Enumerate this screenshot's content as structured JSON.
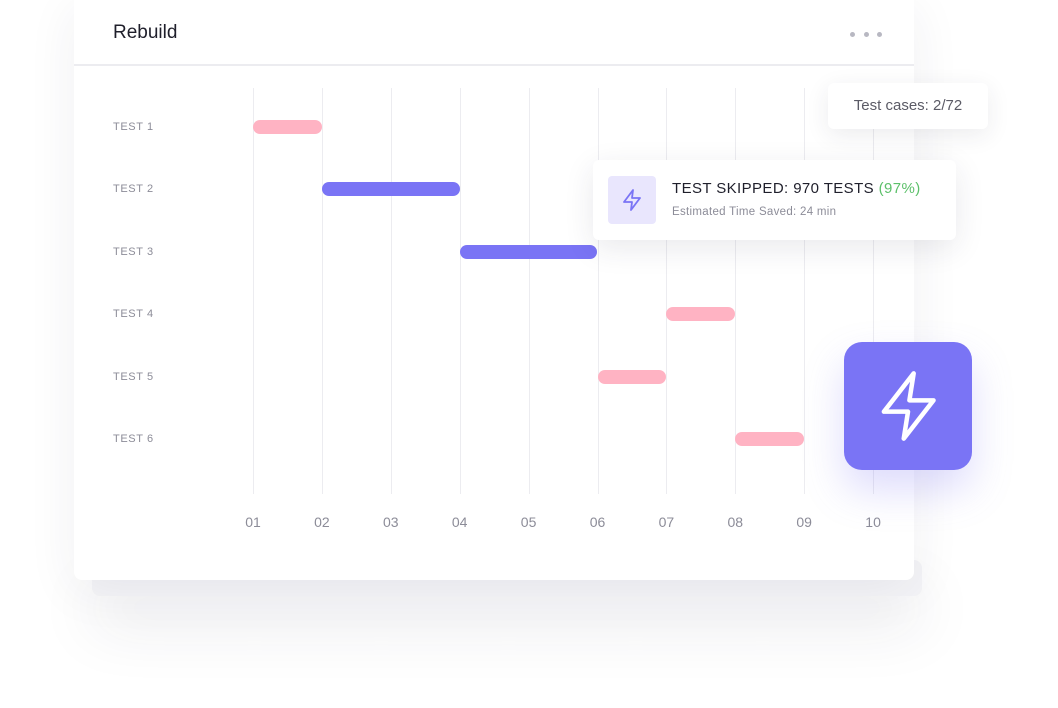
{
  "header": {
    "title": "Rebuild",
    "more_icon": "more-horizontal-icon"
  },
  "badge": {
    "test_cases_label": "Test cases: 2/72"
  },
  "notice": {
    "icon": "lightning-icon",
    "title": "TEST SKIPPED: 970 TESTS",
    "percent": "(97%)",
    "subtitle": "Estimated Time Saved: 24 min",
    "percent_color": "#5cc06a"
  },
  "action_tile": {
    "icon": "lightning-icon",
    "color": "#7a74f5"
  },
  "colors": {
    "pink": "#ffb3c3",
    "purple": "#7a74f5"
  },
  "chart_data": {
    "type": "gantt",
    "x_ticks": [
      "01",
      "02",
      "03",
      "04",
      "05",
      "06",
      "07",
      "08",
      "09",
      "10"
    ],
    "tasks": [
      {
        "label": "TEST 1",
        "start": 1,
        "end": 2,
        "color": "pink"
      },
      {
        "label": "TEST 2",
        "start": 2,
        "end": 4,
        "color": "purple"
      },
      {
        "label": "TEST 3",
        "start": 4,
        "end": 6,
        "color": "purple"
      },
      {
        "label": "TEST 4",
        "start": 7,
        "end": 8,
        "color": "pink"
      },
      {
        "label": "TEST 5",
        "start": 6,
        "end": 7,
        "color": "pink"
      },
      {
        "label": "TEST 6",
        "start": 8,
        "end": 9,
        "color": "pink"
      }
    ]
  }
}
